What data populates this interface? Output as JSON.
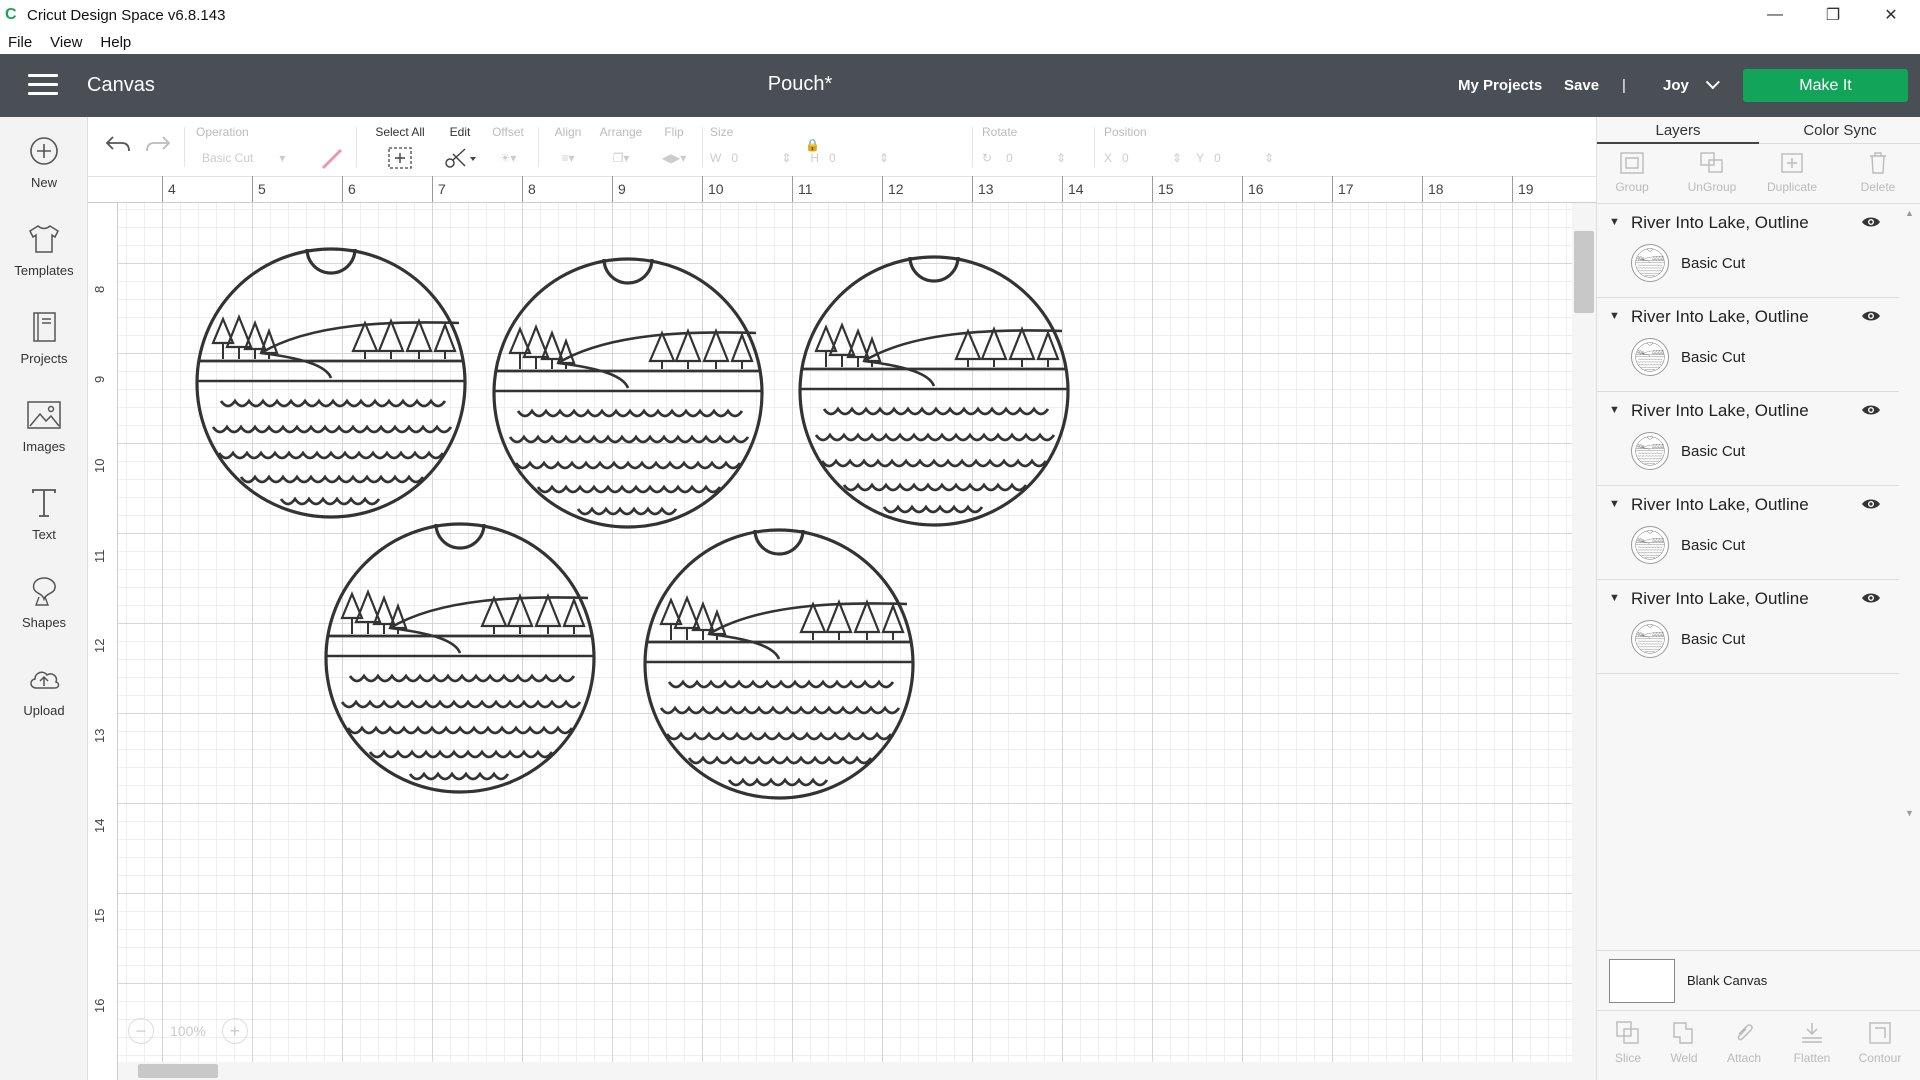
{
  "window": {
    "title": "Cricut Design Space  v6.8.143"
  },
  "menu": [
    "File",
    "View",
    "Help"
  ],
  "header": {
    "canvas_label": "Canvas",
    "doc_title": "Pouch*",
    "my_projects": "My Projects",
    "save": "Save",
    "separator": "|",
    "user": "Joy",
    "make_it": "Make It"
  },
  "sidebar": [
    {
      "label": "New",
      "icon": "plus-circle-icon"
    },
    {
      "label": "Templates",
      "icon": "shirt-icon"
    },
    {
      "label": "Projects",
      "icon": "book-icon"
    },
    {
      "label": "Images",
      "icon": "image-icon"
    },
    {
      "label": "Text",
      "icon": "text-icon"
    },
    {
      "label": "Shapes",
      "icon": "shapes-icon"
    },
    {
      "label": "Upload",
      "icon": "cloud-upload-icon"
    }
  ],
  "toolbar": {
    "operation_label": "Operation",
    "operation_value": "Basic Cut",
    "select_all": "Select All",
    "edit": "Edit",
    "offset": "Offset",
    "align": "Align",
    "arrange": "Arrange",
    "flip": "Flip",
    "size": "Size",
    "w_label": "W",
    "w_value": "0",
    "h_label": "H",
    "h_value": "0",
    "rotate": "Rotate",
    "rotate_value": "0",
    "position": "Position",
    "x_label": "X",
    "x_value": "0",
    "y_label": "Y",
    "y_value": "0"
  },
  "ruler": {
    "top": [
      "4",
      "5",
      "6",
      "7",
      "8",
      "9",
      "10",
      "11",
      "12",
      "13",
      "14",
      "15",
      "16",
      "17",
      "18",
      "19"
    ],
    "left": [
      "8",
      "9",
      "10",
      "11",
      "12",
      "13",
      "14",
      "15",
      "16"
    ]
  },
  "zoom": {
    "value": "100%",
    "minus": "−",
    "plus": "+"
  },
  "panel": {
    "tabs": [
      "Layers",
      "Color Sync"
    ],
    "tools": [
      "Group",
      "UnGroup",
      "Duplicate",
      "Delete"
    ],
    "layers": [
      {
        "name": "River Into Lake, Outline",
        "operation": "Basic Cut"
      },
      {
        "name": "River Into Lake, Outline",
        "operation": "Basic Cut"
      },
      {
        "name": "River Into Lake, Outline",
        "operation": "Basic Cut"
      },
      {
        "name": "River Into Lake, Outline",
        "operation": "Basic Cut"
      },
      {
        "name": "River Into Lake, Outline",
        "operation": "Basic Cut"
      }
    ],
    "blank_canvas": "Blank Canvas",
    "bottom_tools": [
      "Slice",
      "Weld",
      "Attach",
      "Flatten",
      "Contour"
    ]
  },
  "colors": {
    "header_bg": "#494f55",
    "make_it_bg": "#12a55a",
    "design_stroke": "#333333"
  }
}
